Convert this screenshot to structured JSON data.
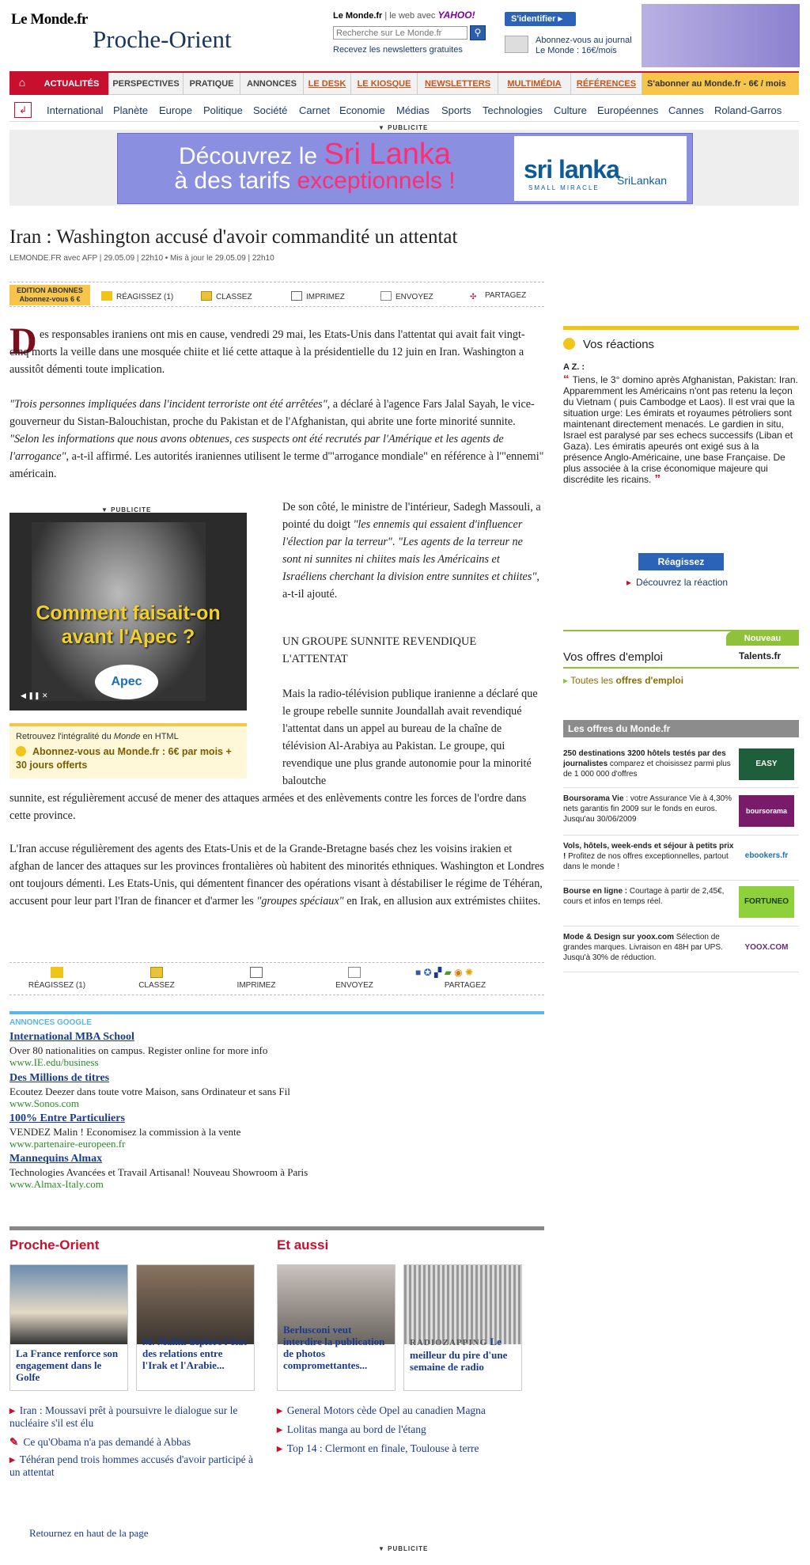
{
  "header": {
    "logo": "Le Monde.fr",
    "section": "Proche-Orient",
    "site": "Le Monde.fr",
    "web_with": "| le web avec",
    "yahoo": "YAHOO!",
    "search_placeholder": "Recherche sur Le Monde.fr",
    "newsletter": "Recevez les newsletters gratuites",
    "login": "S'identifier ▸",
    "journal_line1": "Abonnez-vous au journal",
    "journal_line2": "Le Monde : 16€/mois"
  },
  "nav": {
    "tabs": [
      "ACTUALITÉS",
      "PERSPECTIVES",
      "PRATIQUE",
      "ANNONCES",
      "LE DESK",
      "LE KIOSQUE",
      "NEWSLETTERS",
      "MULTIMÉDIA",
      "RÉFÉRENCES"
    ],
    "subscribe": "S'abonner au Monde.fr - 6€ / mois",
    "sublinks": [
      "International",
      "Planète",
      "Europe",
      "Politique",
      "Société",
      "Carnet",
      "Economie",
      "Médias",
      "Sports",
      "Technologies",
      "Culture",
      "Européennes",
      "Cannes",
      "Roland-Garros"
    ]
  },
  "ad_label": "▼ PUBLICITE",
  "banner": {
    "line1a": "Découvrez le ",
    "line1b": "Sri Lanka",
    "line2a": "à des tarifs ",
    "line2b": "exceptionnels !",
    "logo": "sri lanka",
    "tagline": "SMALL MIRACLE",
    "airline": "SriLankan"
  },
  "article": {
    "headline": "Iran : Washington accusé d'avoir commandité un attentat",
    "byline": "LEMONDE.FR avec AFP | 29.05.09 | 22h10 • Mis à jour le 29.05.09 | 22h10",
    "edition_badge_line1": "EDITION ABONNES",
    "edition_badge_line2": "Abonnez-vous 6 €",
    "tools": [
      "RÉAGISSEZ (1)",
      "CLASSEZ",
      "IMPRIMEZ",
      "ENVOYEZ",
      "PARTAGEZ"
    ],
    "dropcap": "D",
    "p1": "es responsables iraniens ont mis en cause, vendredi 29 mai, les Etats-Unis dans l'attentat qui avait fait vingt-cinq morts la veille dans une mosquée chiite et lié cette attaque à la présidentielle du 12 juin en Iran. Washington a aussitôt démenti toute implication.",
    "p2_q1": "\"Trois personnes impliquées dans l'incident terroriste ont été arrêtées\"",
    "p2_t1": ", a déclaré à l'agence Fars Jalal Sayah, le vice-gouverneur du Sistan-Balouchistan, proche du Pakistan et de l'Afghanistan, qui abrite une forte minorité sunnite. ",
    "p2_q2": "\"Selon les informations que nous avons obtenues, ces suspects ont été recrutés par l'Amérique et les agents de l'arrogance\"",
    "p2_t2": ", a-t-il affirmé. Les autorités iraniennes utilisent le terme d'\"arrogance mondiale\" en référence à l'\"ennemi\" américain.",
    "p3_t1": "De son côté, le ministre de l'intérieur, Sadegh Massouli, a pointé du doigt ",
    "p3_q1": "\"les ennemis qui essaient d'influencer l'élection par la terreur\"",
    "p3_t2": ". ",
    "p3_q2": "\"Les agents de la terreur ne sont ni sunnites ni chiites mais les Américains et Israéliens cherchant la division entre sunnites et chiites\"",
    "p3_t3": ", a-t-il ajouté.",
    "subhead": "UN GROUPE SUNNITE REVENDIQUE L'ATTENTAT",
    "p4": "Mais la radio-télévision publique iranienne a déclaré que le groupe rebelle sunnite Joundallah avait revendiqué l'attentat dans un appel au bureau de la chaîne de télévision Al-Arabiya au Pakistan. Le groupe, qui revendique une plus grande autonomie pour la minorité baloutche",
    "p4b": "sunnite, est régulièrement accusé de mener des attaques armées et des enlèvements contre les forces de l'ordre dans cette province.",
    "p5_t1": "L'Iran accuse régulièrement des agents des Etats-Unis et de la Grande-Bretagne basés chez les voisins irakien et afghan de lancer des attaques sur les provinces frontalières où habitent des minorités ethniques. Washington et Londres ont toujours démenti. Les Etats-Unis, qui démentent financer des opérations visant à déstabiliser le régime de Téhéran, accusent pour leur part l'Iran de financer et d'armer les ",
    "p5_q": "\"groupes spéciaux\"",
    "p5_t2": " en Irak, en allusion aux extrémistes chiites."
  },
  "pub": {
    "text": "Comment faisait-on avant l'Apec ?",
    "logo": "Apec",
    "controls": "◀ ❚❚ ✕"
  },
  "promo": {
    "line1a": "Retrouvez l'intégralité du ",
    "line1b": "Monde",
    "line1c": " en HTML",
    "line2": "Abonnez-vous au Monde.fr : 6€ par mois + 30 jours offerts"
  },
  "google_ads": {
    "label": "ANNONCES GOOGLE",
    "items": [
      {
        "title": "International MBA School",
        "desc": "Over 80 nationalities on campus. Register online for more info",
        "url": "www.IE.edu/business"
      },
      {
        "title": "Des Millions de titres",
        "desc": "Ecoutez Deezer dans toute votre Maison, sans Ordinateur et sans Fil",
        "url": "www.Sonos.com"
      },
      {
        "title": "100% Entre Particuliers",
        "desc": "VENDEZ Malin ! Economisez la commission à la vente",
        "url": "www.partenaire-europeen.fr"
      },
      {
        "title": "Mannequins Almax",
        "desc": "Technologies Avancées et Travail Artisanal! Nouveau Showroom à Paris",
        "url": "www.Almax-Italy.com"
      }
    ]
  },
  "related": {
    "left_title": "Proche-Orient",
    "right_title": "Et aussi",
    "cards": [
      {
        "text": "La France renforce son engagement dans le Golfe"
      },
      {
        "text": "M. Maliki déplore l'état des relations entre l'Irak et l'Arabie..."
      },
      {
        "text": "Berlusconi veut interdire la publication de photos compromettantes..."
      },
      {
        "tag": "RADIOZAPPING",
        "text": " Le meilleur du pire d'une semaine de radio"
      }
    ],
    "left_links": [
      "Iran : Moussavi prêt à poursuivre le dialogue sur le nucléaire s'il est élu",
      "Ce qu'Obama n'a pas demandé à Abbas",
      "Téhéran pend trois hommes accusés d'avoir participé à un attentat"
    ],
    "right_links": [
      "General Motors cède Opel au canadien Magna",
      "Lolitas manga au bord de l'étang",
      "Top 14 : Clermont en finale, Toulouse à terre"
    ]
  },
  "back_top": "Retournez en haut de la page",
  "sidebar": {
    "reactions_title": "Vos réactions",
    "reaction_author": "A Z. :",
    "reaction_text": "Tiens, le 3° domino après Afghanistan, Pakistan: Iran. Apparemment les Américains n'ont pas retenu la leçon du Vietnam ( puis Cambodge et Laos). Il est vrai que la situation urge: Les émirats et royaumes pétroliers sont maintenant directement menacés. Le gardien in situ, Israel est paralysé par ses echecs successifs (Liban et Gaza). Les émiratis apeurés ont exigé sus à la présence Anglo-Américaine, une base Française. De plus associée à la crise économique majeure qui discrédite les ricains.",
    "react_button": "Réagissez",
    "discover": "Découvrez la réaction",
    "jobs_new": "Nouveau",
    "jobs_title": "Vos offres d'emploi",
    "jobs_brand": "Talents.fr",
    "jobs_link_a": "Toutes les ",
    "jobs_link_b": "offres d'emploi",
    "offers_title": "Les offres du Monde.fr",
    "offers": [
      {
        "bold": "250 destinations 3200 hôtels testés par des journalistes",
        "text": " comparez et choisissez parmi plus de 1 000 000 d'offres",
        "logo": "EASY VOYAGE"
      },
      {
        "bold": "Boursorama Vie",
        "text": " : votre Assurance Vie à 4,30% nets garantis fin 2009 sur le fonds en euros. Jusqu'au 30/06/2009",
        "logo": "boursorama banque"
      },
      {
        "bold": "Vols, hôtels, week-ends et séjour à petits prix !",
        "text": " Profitez de nos offres exceptionnelles, partout dans le monde !",
        "logo": "ebookers.fr"
      },
      {
        "bold": "Bourse en ligne :",
        "text": " Courtage à partir de 2,45€, cours et infos en temps réel.",
        "logo": "FORTUNEO"
      },
      {
        "bold": "Mode & Design sur yoox.com",
        "text": " Sélection de grandes marques. Livraison en 48H par UPS. Jusqu'à 30% de réduction.",
        "logo": "YOOX.COM"
      }
    ]
  },
  "colors": {
    "accent": "#c8102e",
    "link": "#1a3a6e",
    "gold": "#f7c54a",
    "green": "#8fc23a"
  }
}
